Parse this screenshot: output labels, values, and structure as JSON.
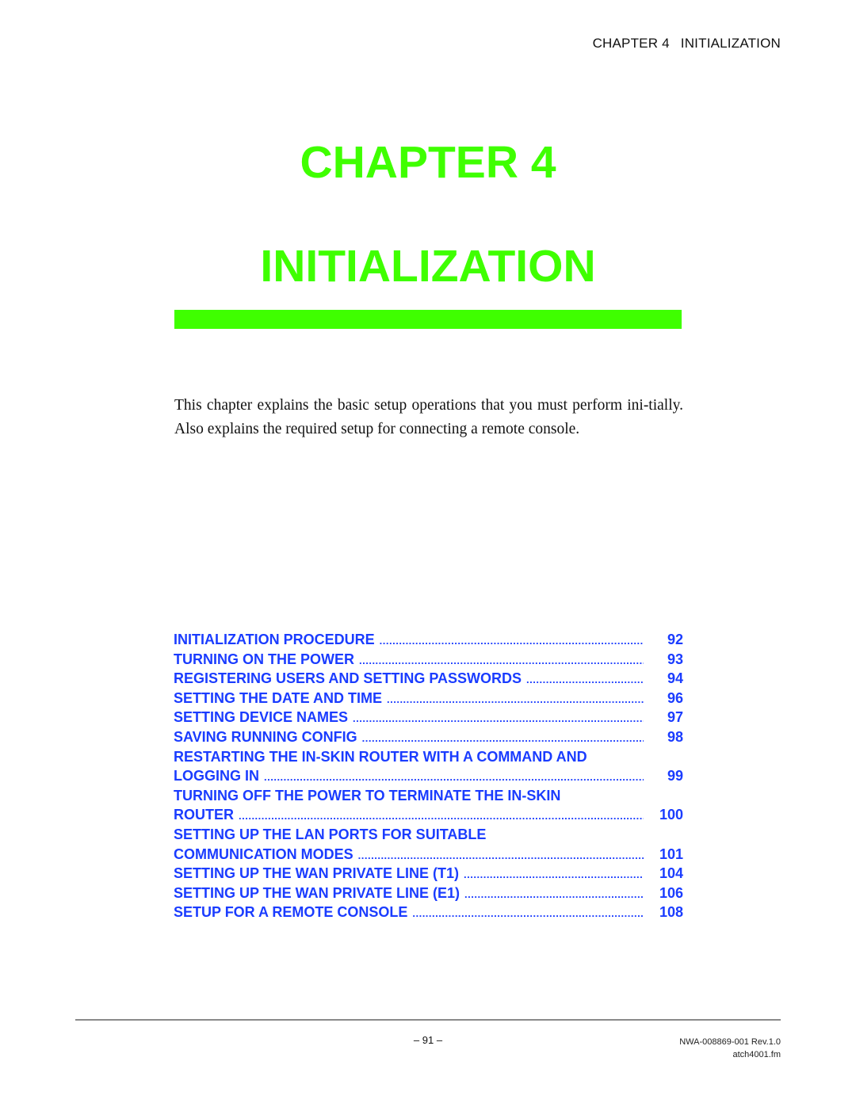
{
  "header": {
    "chapter_label": "CHAPTER 4",
    "chapter_name": "INITIALIZATION"
  },
  "title": {
    "line1": "CHAPTER 4",
    "line2": "INITIALIZATION"
  },
  "colors": {
    "accent_green": "#3fff00",
    "toc_blue": "#1a3cff"
  },
  "intro": "This chapter explains the basic setup operations that you must perform ini-tially. Also explains the required setup for connecting a remote console.",
  "toc": [
    {
      "title": "INITIALIZATION PROCEDURE",
      "page": "92"
    },
    {
      "title": "TURNING ON THE POWER",
      "page": "93"
    },
    {
      "title": "REGISTERING USERS AND SETTING PASSWORDS",
      "page": "94"
    },
    {
      "title": "SETTING THE DATE AND TIME",
      "page": "96"
    },
    {
      "title": "SETTING DEVICE NAMES",
      "page": "97"
    },
    {
      "title": "SAVING RUNNING CONFIG",
      "page": "98"
    },
    {
      "title_line1": "RESTARTING THE IN-SKIN ROUTER WITH A COMMAND AND",
      "title": "LOGGING IN",
      "page": "99"
    },
    {
      "title_line1": "TURNING OFF THE POWER TO TERMINATE THE IN-SKIN",
      "title": "ROUTER",
      "page": "100"
    },
    {
      "title_line1": "SETTING UP THE LAN PORTS FOR SUITABLE",
      "title": "COMMUNICATION MODES",
      "page": "101"
    },
    {
      "title": "SETTING UP THE WAN PRIVATE LINE (T1)",
      "page": "104"
    },
    {
      "title": "SETTING UP THE WAN PRIVATE LINE (E1)",
      "page": "106"
    },
    {
      "title": "SETUP FOR A REMOTE CONSOLE",
      "page": "108"
    }
  ],
  "footer": {
    "page_number": "– 91 –",
    "doc_id": "NWA-008869-001 Rev.1.0",
    "file_name": "atch4001.fm"
  }
}
